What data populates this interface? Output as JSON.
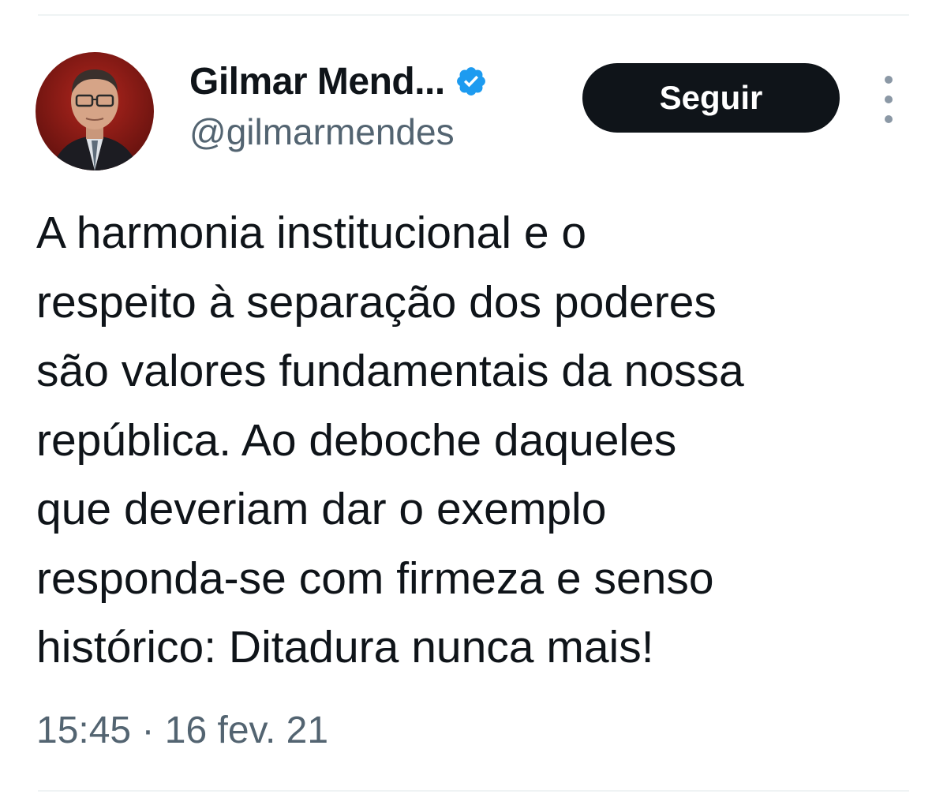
{
  "author": {
    "display_name": "Gilmar Mend...",
    "handle": "@gilmarmendes",
    "verified": true,
    "avatar_icon": "profile-photo"
  },
  "actions": {
    "follow_label": "Seguir",
    "more_icon": "more-vertical-icon"
  },
  "tweet": {
    "lines": [
      "A harmonia institucional e o",
      "respeito à separação dos poderes",
      "são valores fundamentais da nossa",
      "república. Ao deboche daqueles",
      "que deveriam dar o exemplo",
      "responda-se com firmeza e senso",
      "histórico: Ditadura nunca mais!"
    ],
    "timestamp": "15:45 · 16 fev. 21"
  },
  "colors": {
    "verified_badge": "#1d9bf0",
    "button_bg": "#0f1419",
    "secondary_text": "#536471"
  }
}
